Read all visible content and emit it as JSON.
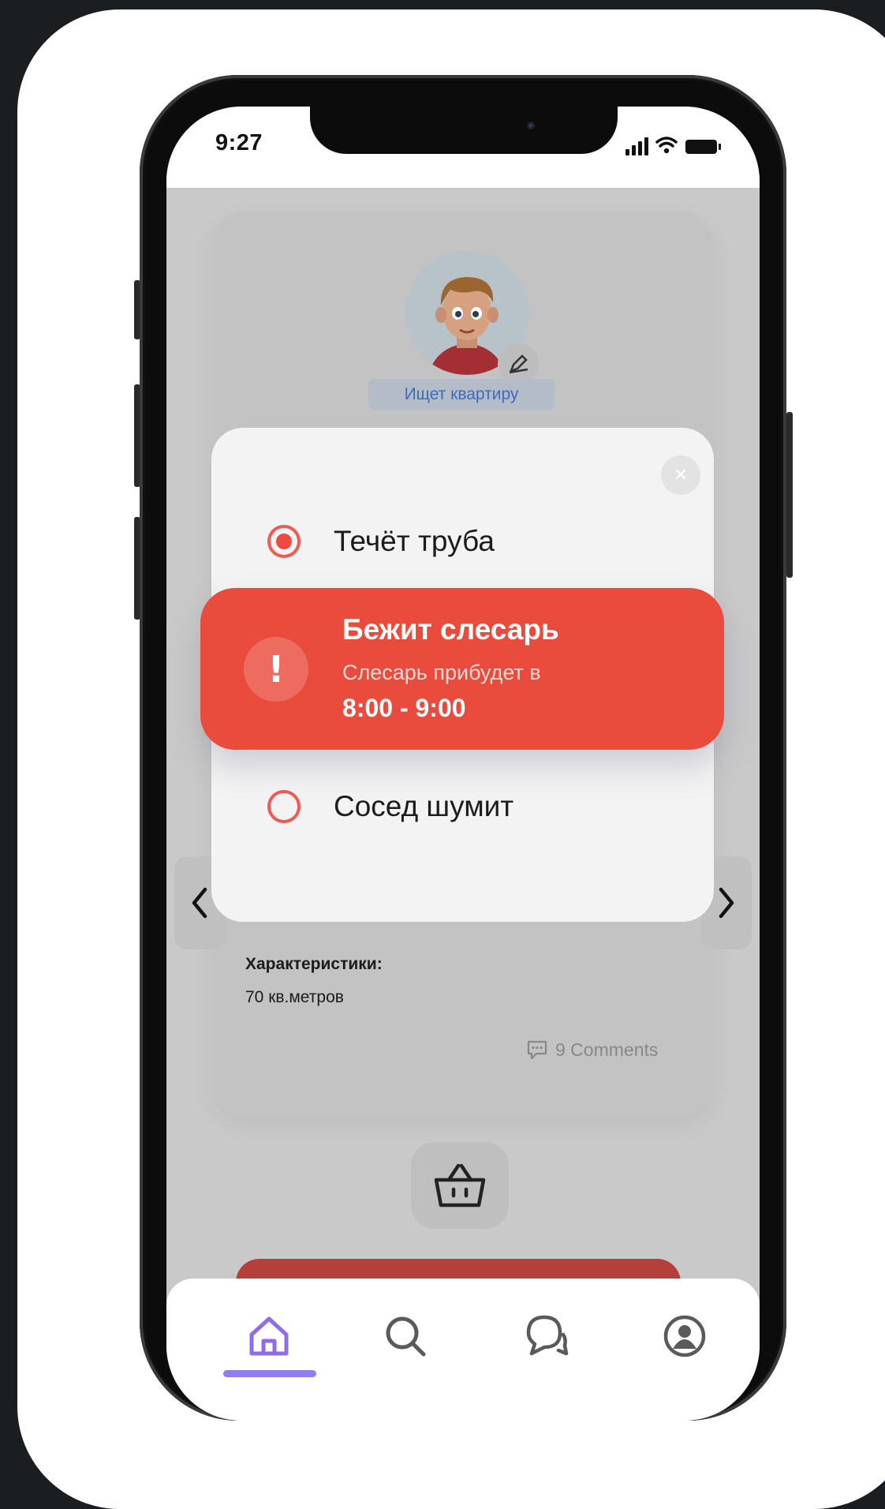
{
  "status_bar": {
    "time": "9:27"
  },
  "profile": {
    "status_pill": "Ищет квартиру"
  },
  "modal": {
    "options": [
      {
        "label": "Течёт труба",
        "selected": true
      },
      {
        "label": "Сосед шумит",
        "selected": false
      }
    ],
    "close_icon": "close-icon"
  },
  "alert": {
    "title": "Бежит слесарь",
    "subtitle": "Слесарь прибудет в",
    "time_range": "8:00 - 9:00",
    "icon": "exclamation-icon"
  },
  "listing": {
    "characteristics_label": "Характеристики:",
    "characteristics_value": "70 кв.метров",
    "comments": "9 Comments"
  },
  "tab_bar": {
    "items": [
      "home-icon",
      "search-icon",
      "chat-icon",
      "profile-icon"
    ],
    "active_index": 0
  },
  "colors": {
    "accent_red": "#e94b3d",
    "tab_active": "#8f7ef0",
    "link_blue": "#3d6bbe"
  }
}
